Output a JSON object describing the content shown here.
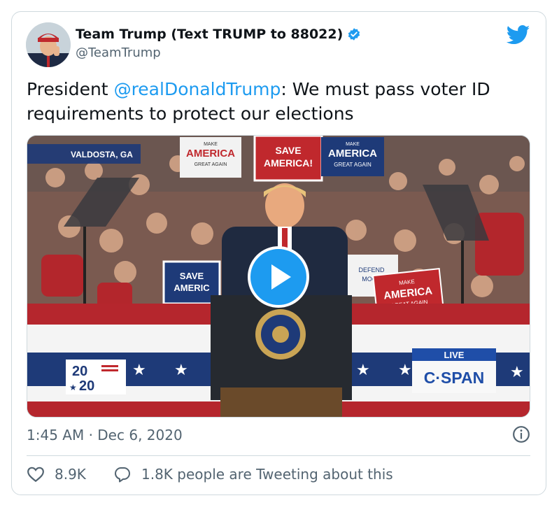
{
  "tweet": {
    "author_name": "Team Trump (Text TRUMP to 88022)",
    "author_handle": "@TeamTrump",
    "text_prefix": "President ",
    "mention": "@realDonaldTrump",
    "text_suffix": ": We must pass voter ID requirements to protect our elections",
    "timestamp": "1:45 AM · Dec 6, 2020",
    "likes": "8.9K",
    "conversation": "1.8K people are Tweeting about this"
  },
  "media": {
    "location_label": "VALDOSTA, GA",
    "live_label": "LIVE",
    "network_label": "C·SPAN",
    "logo_2020_top": "20",
    "logo_2020_bottom": "20",
    "signs": [
      {
        "line1": "MAKE",
        "line2": "AMERICA",
        "line3": "GREAT AGAIN"
      },
      {
        "line1": "SAVE",
        "line2": "AMERICA!"
      },
      {
        "line1": "MAKE",
        "line2": "AMERICA",
        "line3": "GREAT AGAIN"
      },
      {
        "line1": "SAVE",
        "line2": "AMERIC"
      },
      {
        "line1": "DEFEND",
        "line2": "MOCR"
      },
      {
        "line1": "MAKE",
        "line2": "AMERICA",
        "line3": "GREAT AGAIN"
      }
    ]
  },
  "colors": {
    "accent": "#1d9bf0",
    "text": "#0f1419",
    "secondary_text": "#536471",
    "border": "#cfd9de",
    "verified": "#1d9bf0",
    "cspan_blue": "#1f4ea8"
  },
  "icons": [
    "twitter-bird-icon",
    "verified-badge-icon",
    "play-icon",
    "info-icon",
    "heart-icon",
    "reply-icon"
  ]
}
